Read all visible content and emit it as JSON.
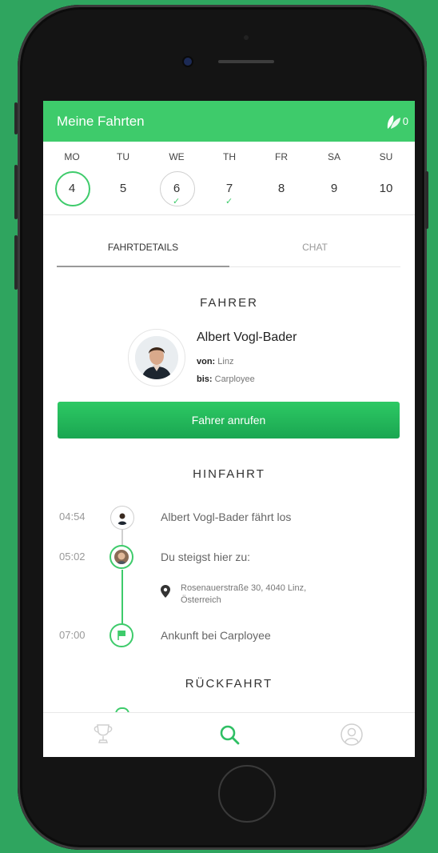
{
  "header": {
    "title": "Meine Fahrten",
    "leaf_count": "0"
  },
  "week": [
    {
      "day": "MO",
      "date": "4",
      "state": "selected"
    },
    {
      "day": "TU",
      "date": "5",
      "state": "none"
    },
    {
      "day": "WE",
      "date": "6",
      "state": "done-ring"
    },
    {
      "day": "TH",
      "date": "7",
      "state": "done"
    },
    {
      "day": "FR",
      "date": "8",
      "state": "none"
    },
    {
      "day": "SA",
      "date": "9",
      "state": "none"
    },
    {
      "day": "SU",
      "date": "10",
      "state": "none"
    }
  ],
  "tabs": {
    "details": "FAHRTDETAILS",
    "chat": "CHAT"
  },
  "driver": {
    "section": "FAHRER",
    "name": "Albert Vogl-Bader",
    "from_label": "von:",
    "from": "Linz",
    "to_label": "bis:",
    "to": "Carployee",
    "call_button": "Fahrer anrufen"
  },
  "outbound": {
    "section": "HINFAHRT",
    "stops": [
      {
        "time": "04:54",
        "text": "Albert Vogl-Bader fährt los"
      },
      {
        "time": "05:02",
        "text": "Du steigst hier zu:"
      },
      {
        "time": "07:00",
        "text": "Ankunft bei Carployee"
      }
    ],
    "address_line1": "Rosenauerstraße 30, 4040 Linz,",
    "address_line2": "Österreich"
  },
  "return": {
    "section": "RÜCKFAHRT"
  },
  "colors": {
    "accent": "#3ecb6b",
    "button": "#1faf57",
    "background": "#2fa55f"
  }
}
